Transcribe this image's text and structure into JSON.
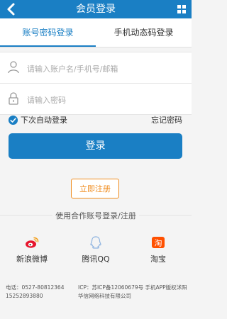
{
  "header": {
    "title": "会员登录"
  },
  "tabs": [
    {
      "label": "账号密码登录",
      "active": true
    },
    {
      "label": "手机动态码登录",
      "active": false
    }
  ],
  "form": {
    "username_placeholder": "请输入账户名/手机号/邮箱",
    "password_placeholder": "请输入密码",
    "username_value": "",
    "password_value": ""
  },
  "remember": {
    "label": "下次自动登录",
    "checked": true
  },
  "forgot_label": "忘记密码",
  "login_label": "登录",
  "register_label": "立即注册",
  "partner_title": "使用合作账号登录/注册",
  "partners": [
    {
      "label": "新浪微博",
      "icon": "weibo-icon"
    },
    {
      "label": "腾讯QQ",
      "icon": "qq-icon"
    },
    {
      "label": "淘宝",
      "icon": "taobao-icon"
    }
  ],
  "footer": {
    "phone_1": "电话：0527-80812364",
    "phone_2": "15252893880",
    "icp": "ICP：苏ICP备12060679号 手机APP版权沭阳华信网络科技有限公司"
  },
  "colors": {
    "primary": "#1a7fc4",
    "accent": "#f08c1e",
    "weibo": "#e6162d",
    "qq": "#8fb4e0",
    "taobao": "#ff5000"
  }
}
